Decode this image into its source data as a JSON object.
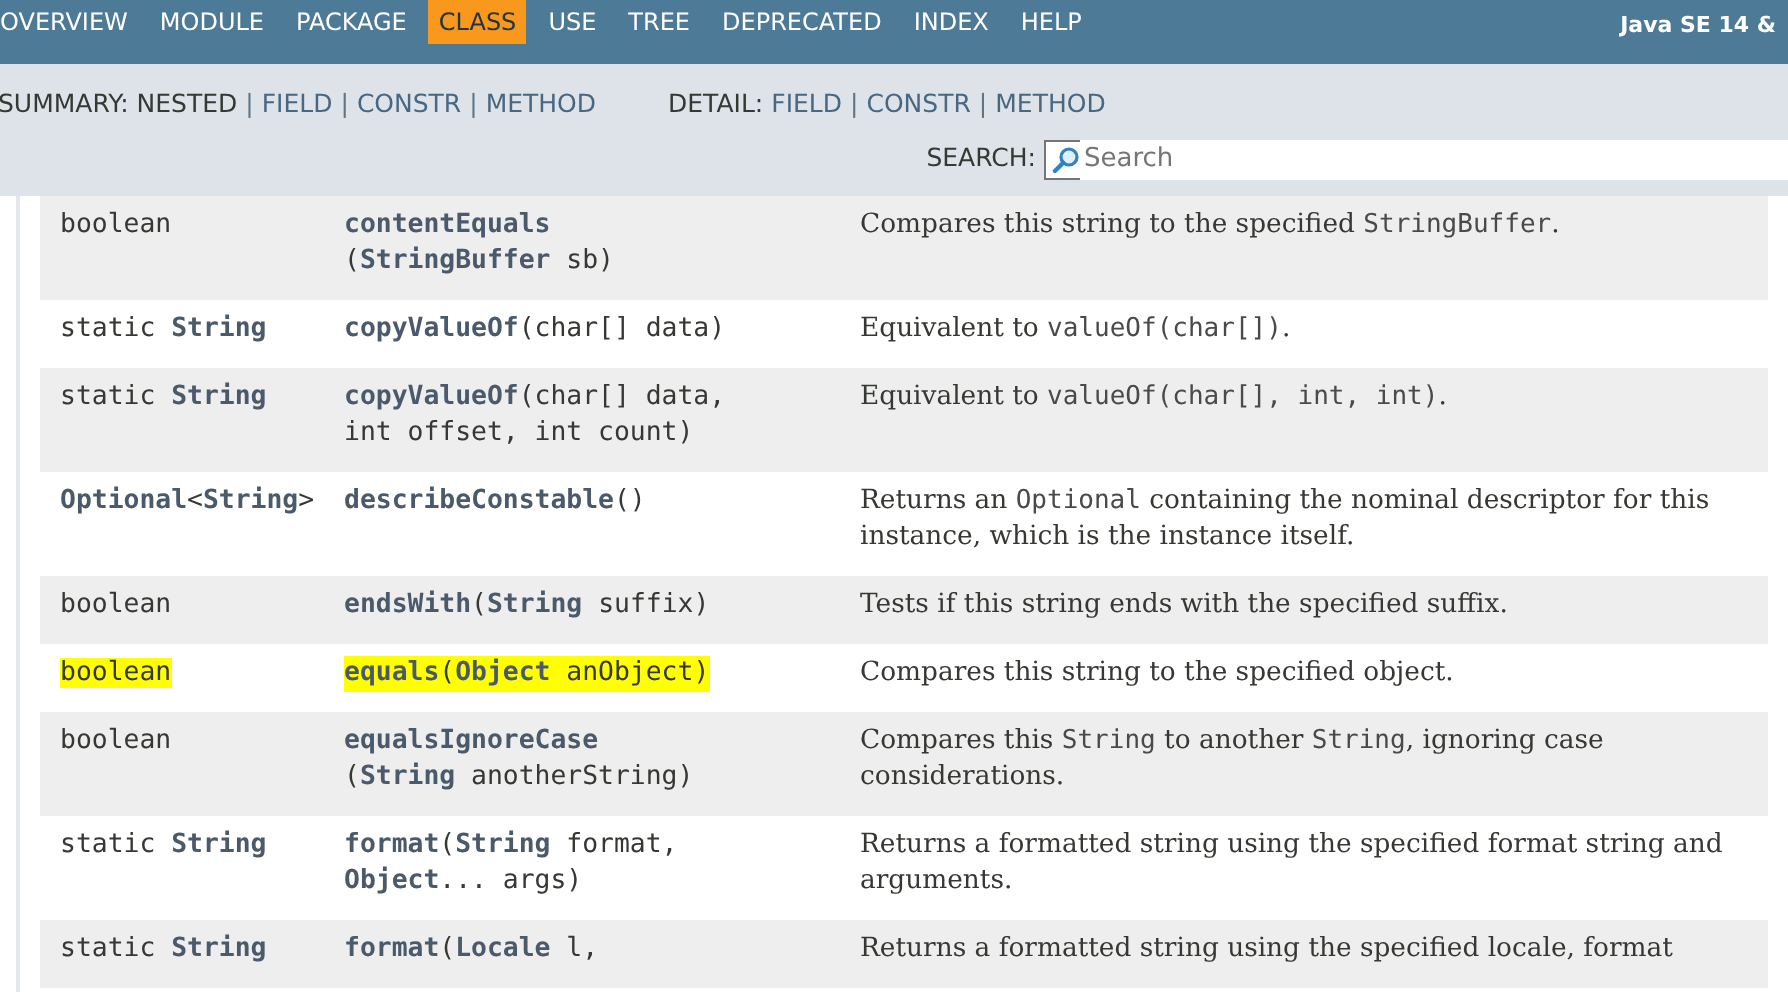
{
  "top_nav": {
    "items": [
      {
        "label": "OVERVIEW",
        "selected": false
      },
      {
        "label": "MODULE",
        "selected": false
      },
      {
        "label": "PACKAGE",
        "selected": false
      },
      {
        "label": "CLASS",
        "selected": true
      },
      {
        "label": "USE",
        "selected": false
      },
      {
        "label": "TREE",
        "selected": false
      },
      {
        "label": "DEPRECATED",
        "selected": false
      },
      {
        "label": "INDEX",
        "selected": false
      },
      {
        "label": "HELP",
        "selected": false
      }
    ],
    "title": "Java SE 14 &"
  },
  "sub_nav": {
    "summary": {
      "label": "SUMMARY:",
      "items": [
        {
          "text": "NESTED",
          "kind": "plain"
        },
        {
          "text": "|",
          "kind": "separator"
        },
        {
          "text": "FIELD",
          "kind": "link"
        },
        {
          "text": "|",
          "kind": "separator"
        },
        {
          "text": "CONSTR",
          "kind": "link"
        },
        {
          "text": "|",
          "kind": "separator"
        },
        {
          "text": "METHOD",
          "kind": "link"
        }
      ]
    },
    "detail": {
      "label": "DETAIL:",
      "items": [
        {
          "text": "FIELD",
          "kind": "link"
        },
        {
          "text": "|",
          "kind": "separator"
        },
        {
          "text": "CONSTR",
          "kind": "link"
        },
        {
          "text": "|",
          "kind": "separator"
        },
        {
          "text": "METHOD",
          "kind": "link"
        }
      ]
    },
    "search": {
      "label": "SEARCH:",
      "placeholder": "Search"
    }
  },
  "methods": [
    {
      "type": "boolean",
      "signature": [
        "**contentEquals**",
        "(**StringBuffer** sb)"
      ],
      "description": [
        {
          "kind": "text",
          "text": "Compares this string to the specified "
        },
        {
          "kind": "code",
          "text": "StringBuffer"
        },
        {
          "kind": "text",
          "text": "."
        }
      ],
      "highlighted": false
    },
    {
      "type": "static **String**",
      "signature": [
        "**copyValueOf**(char[] data)"
      ],
      "description": [
        {
          "kind": "text",
          "text": "Equivalent to "
        },
        {
          "kind": "code",
          "text": "valueOf(char[])"
        },
        {
          "kind": "text",
          "text": "."
        }
      ],
      "highlighted": false
    },
    {
      "type": "static **String**",
      "signature": [
        "**copyValueOf**(char[] data,",
        "int offset, int count)"
      ],
      "description": [
        {
          "kind": "text",
          "text": "Equivalent to "
        },
        {
          "kind": "code",
          "text": "valueOf(char[], int, int)"
        },
        {
          "kind": "text",
          "text": "."
        }
      ],
      "highlighted": false
    },
    {
      "type": "**Optional**<**String**>",
      "signature": [
        "**describeConstable**()"
      ],
      "description": [
        {
          "kind": "text",
          "text": "Returns an "
        },
        {
          "kind": "code",
          "text": "Optional"
        },
        {
          "kind": "text",
          "text": " containing the nominal descriptor for this instance, which is the instance itself."
        }
      ],
      "highlighted": false
    },
    {
      "type": "boolean",
      "signature": [
        "**endsWith**(**String** suffix)"
      ],
      "description": [
        {
          "kind": "text",
          "text": "Tests if this string ends with the specified suffix."
        }
      ],
      "highlighted": false
    },
    {
      "type": "boolean",
      "signature": [
        "**equals**(**Object** anObject)"
      ],
      "description": [
        {
          "kind": "text",
          "text": "Compares this string to the specified object."
        }
      ],
      "highlighted": true
    },
    {
      "type": "boolean",
      "signature": [
        "**equalsIgnoreCase**",
        "(**String** anotherString)"
      ],
      "description": [
        {
          "kind": "text",
          "text": "Compares this "
        },
        {
          "kind": "code",
          "text": "String"
        },
        {
          "kind": "text",
          "text": " to another "
        },
        {
          "kind": "code",
          "text": "String"
        },
        {
          "kind": "text",
          "text": ", ignoring case considerations."
        }
      ],
      "highlighted": false
    },
    {
      "type": "static **String**",
      "signature": [
        "**format**(**String** format,",
        "**Object**... args)"
      ],
      "description": [
        {
          "kind": "text",
          "text": "Returns a formatted string using the specified format string and arguments."
        }
      ],
      "highlighted": false
    },
    {
      "type": "static **String**",
      "signature": [
        "**format**(**Locale** l,"
      ],
      "description": [
        {
          "kind": "text",
          "text": "Returns a formatted string using the specified locale, format"
        }
      ],
      "highlighted": false
    }
  ]
}
